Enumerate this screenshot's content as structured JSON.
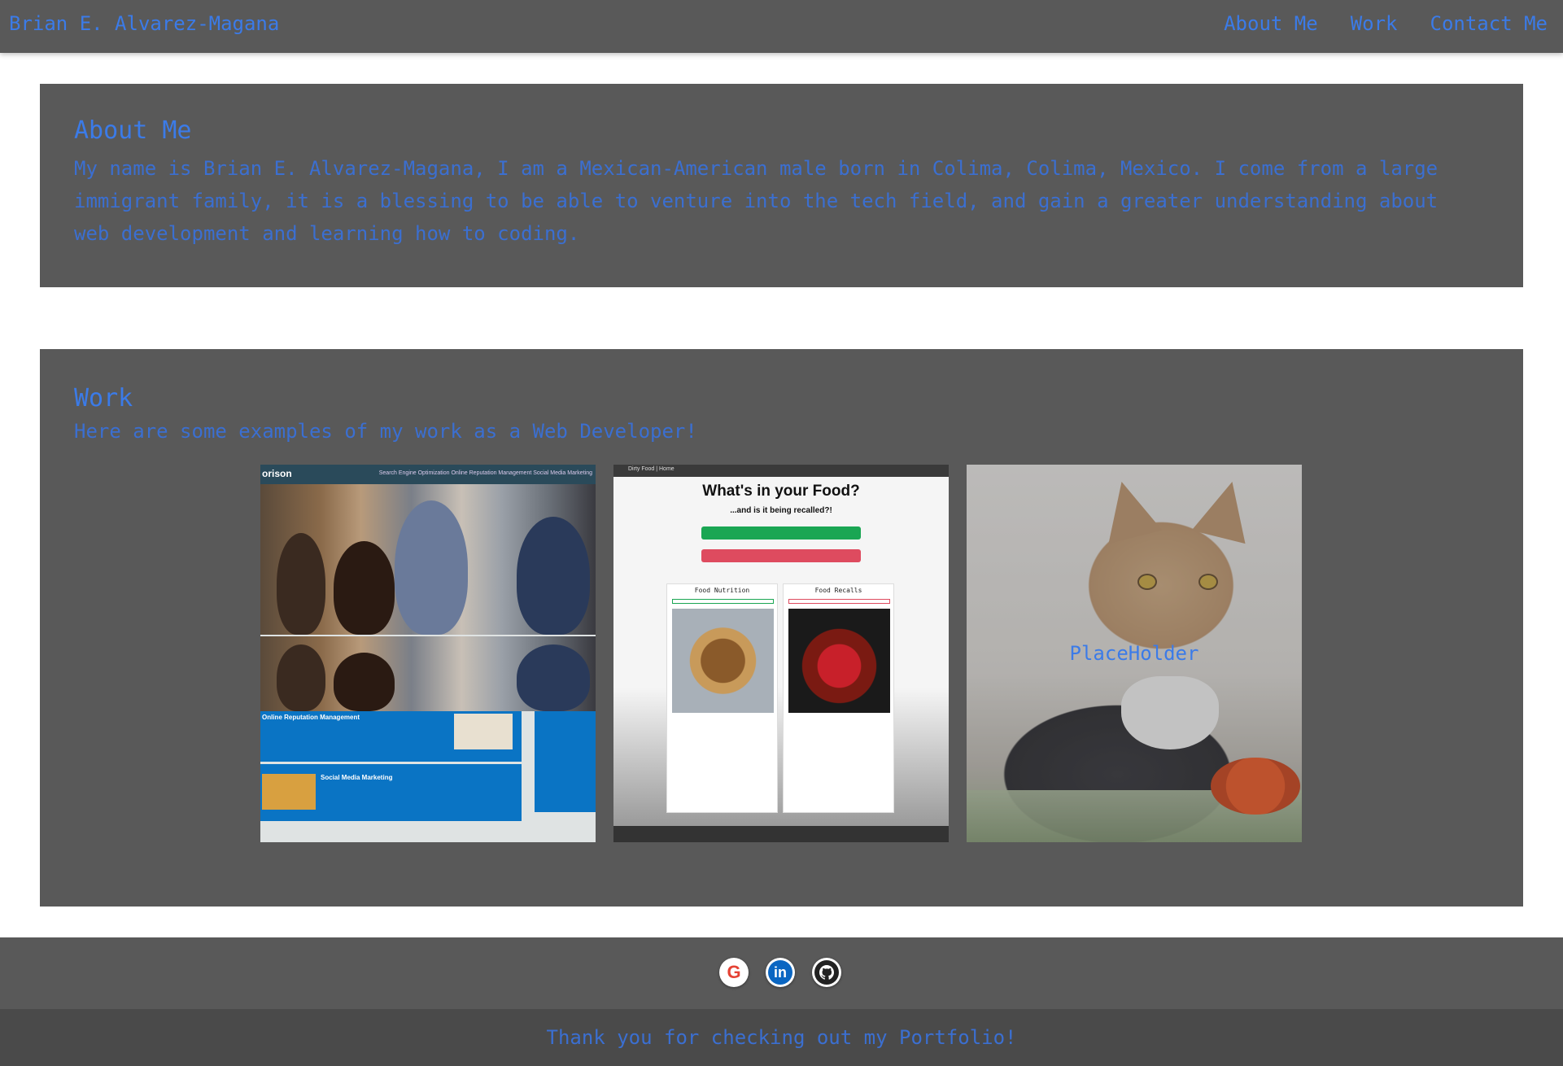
{
  "nav": {
    "brand": "Brian E. Alvarez-Magana",
    "links": [
      "About Me",
      "Work",
      "Contact Me"
    ]
  },
  "about": {
    "heading": "About Me",
    "text": "My name is Brian E. Alvarez-Magana, I am a Mexican-American male born in Colima, Colima, Mexico. I come from a large immigrant family, it is a blessing to be able to venture into the tech field, and gain a greater understanding about web development and learning how to coding."
  },
  "work": {
    "heading": "Work",
    "intro": "Here are some examples of my work as a Web Developer!",
    "projects": [
      {
        "logo": "orison",
        "nav": "Search Engine Optimization   Online Reputation Management   Social Media Marketing",
        "section1": "Online Reputation Management",
        "section2": "Social Media Marketing"
      },
      {
        "bar_title": "Dirty Food | Home",
        "headline": "What's in your Food?",
        "subheadline": "...and is it being recalled?!",
        "col1": "Food Nutrition",
        "col2": "Food Recalls"
      },
      {
        "label": "PlaceHolder"
      }
    ]
  },
  "socials": [
    "google-icon",
    "linkedin-icon",
    "github-icon"
  ],
  "footer": {
    "text": "Thank you for checking out my Portfolio!"
  },
  "colors": {
    "panel": "#595959",
    "accent": "#3b7be8",
    "footer": "#4a4a4a"
  }
}
